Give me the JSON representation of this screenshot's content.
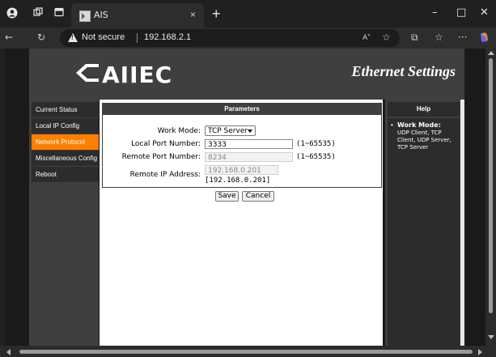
{
  "browser": {
    "tab_title": "AIS",
    "tab_close_glyph": "×",
    "new_tab_glyph": "+",
    "security_label": "Not secure",
    "url": "192.168.2.1",
    "icons": [
      "profile-icon",
      "workspaces-icon",
      "tab-actions-icon",
      "back-icon",
      "refresh-icon",
      "warning-icon",
      "read-aloud-icon",
      "favorite-icon",
      "split-screen-icon",
      "favorites-icon",
      "more-icon",
      "copilot-icon"
    ],
    "window_controls": {
      "minimize": "–",
      "maximize": "□",
      "close": "✕"
    }
  },
  "site": {
    "logo_text": "AIIEC",
    "page_heading": "Ethernet Settings",
    "nav": [
      {
        "label": "Current Status",
        "active": false
      },
      {
        "label": "Local IP Config",
        "active": false
      },
      {
        "label": "Network Protocol",
        "active": true
      },
      {
        "label": "Miscellaneous Config",
        "active": false
      },
      {
        "label": "Reboot",
        "active": false
      }
    ],
    "params": {
      "title": "Parameters",
      "work_mode_label": "Work Mode:",
      "work_mode_value": "TCP Server",
      "local_port_label": "Local Port Number:",
      "local_port_value": "3333",
      "local_port_range": "(1~65535)",
      "remote_port_label": "Remote Port Number:",
      "remote_port_value": "8234",
      "remote_port_range": "(1~65535)",
      "remote_ip_label": "Remote IP Address:",
      "remote_ip_value": "192.168.0.201",
      "remote_ip_current": "[192.168.0.201]"
    },
    "buttons": {
      "save": "Save",
      "cancel": "Cancel"
    },
    "help": {
      "title": "Help",
      "bullet": "•",
      "term": "Work Mode:",
      "description": "UDP Client, TCP Client, UDP Server, TCP Server"
    }
  },
  "colors": {
    "accent": "#ff7f00",
    "panel": "#3f3f3f",
    "browser_bg": "#202020"
  }
}
